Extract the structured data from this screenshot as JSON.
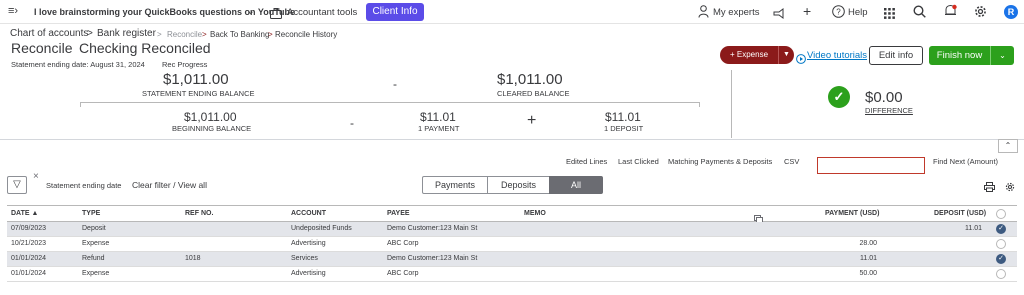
{
  "topbar": {
    "menu_icon": "menu-collapse-icon",
    "company": "I love brainstorming your QuickBooks questions on YouTube",
    "accountant_tools": "Accountant tools",
    "client_info": "Client Info",
    "my_experts": "My experts",
    "help": "Help",
    "avatar_initial": "R"
  },
  "breadcrumb": {
    "chart_of_accounts": "Chart of accounts",
    "sep1": ">",
    "bank_register": "Bank register",
    "sep2": ">",
    "reconcile": "Reconcile",
    "sep3": ">",
    "back_to_banking": "Back To Banking",
    "sep4": ">",
    "reconcile_history": "Reconcile History"
  },
  "header": {
    "title": "Reconcile",
    "account": "Checking Reconciled",
    "statement_date": "Statement ending date: August 31, 2024",
    "rec_progress": "Rec Progress"
  },
  "actions": {
    "expense": "+ Expense",
    "video_tutorials": "Video tutorials",
    "edit_info": "Edit info",
    "finish_now": "Finish now"
  },
  "summary": {
    "statement_ending_balance": "$1,011.00",
    "statement_ending_balance_label": "STATEMENT ENDING BALANCE",
    "minus1": "-",
    "cleared_balance": "$1,011.00",
    "cleared_balance_label": "CLEARED BALANCE",
    "beginning_balance": "$1,011.00",
    "beginning_balance_label": "BEGINNING BALANCE",
    "minus2": "-",
    "payments_amount": "$11.01",
    "payments_label": "1 PAYMENT",
    "plus": "+",
    "deposits_amount": "$11.01",
    "deposits_label": "1 DEPOSIT",
    "difference": "$0.00",
    "difference_label": "DIFFERENCE"
  },
  "tools": {
    "edited_lines": "Edited Lines",
    "last_clicked": "Last Clicked",
    "matching": "Matching Payments & Deposits",
    "csv": "CSV",
    "find_next": "Find Next (Amount)",
    "find_value": ""
  },
  "filter": {
    "close": "×",
    "statement_ending_date": "Statement ending date",
    "clear_filter": "Clear filter / View all",
    "tabs": [
      "Payments",
      "Deposits",
      "All"
    ],
    "active_tab": "All"
  },
  "table": {
    "headers": {
      "date": "DATE ▲",
      "type": "TYPE",
      "ref": "REF NO.",
      "account": "ACCOUNT",
      "payee": "PAYEE",
      "memo": "MEMO",
      "payment": "PAYMENT (USD)",
      "deposit": "DEPOSIT (USD)"
    },
    "rows": [
      {
        "date": "07/09/2023",
        "type": "Deposit",
        "ref": "",
        "account": "Undeposited Funds",
        "payee": "Demo Customer:123 Main St",
        "memo": "",
        "payment": "",
        "deposit": "11.01",
        "checked": true
      },
      {
        "date": "10/21/2023",
        "type": "Expense",
        "ref": "",
        "account": "Advertising",
        "payee": "ABC Corp",
        "memo": "",
        "payment": "28.00",
        "deposit": "",
        "checked": false
      },
      {
        "date": "01/01/2024",
        "type": "Refund",
        "ref": "1018",
        "account": "Services",
        "payee": "Demo Customer:123 Main St",
        "memo": "",
        "payment": "11.01",
        "deposit": "",
        "checked": true
      },
      {
        "date": "01/01/2024",
        "type": "Expense",
        "ref": "",
        "account": "Advertising",
        "payee": "ABC Corp",
        "memo": "",
        "payment": "50.00",
        "deposit": "",
        "checked": false
      }
    ]
  },
  "colors": {
    "accent_green": "#2ca01c",
    "expense_red": "#8b1a1a",
    "client_purple": "#5b4ce8",
    "link_blue": "#0077c5"
  }
}
